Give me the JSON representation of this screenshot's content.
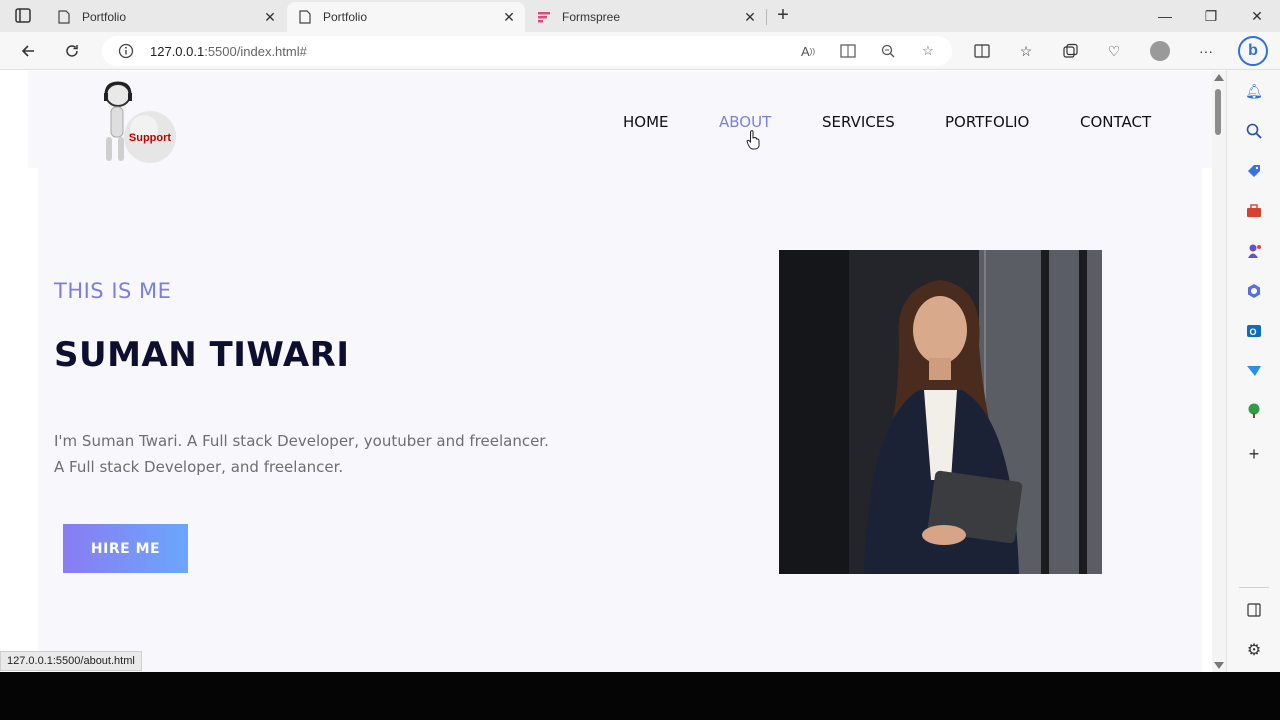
{
  "browser": {
    "tabs": [
      {
        "title": "Portfolio",
        "active": false
      },
      {
        "title": "Portfolio",
        "active": true
      },
      {
        "title": "Formspree",
        "active": false
      }
    ],
    "url_host": "127.0.0.1",
    "url_rest": ":5500/index.html#",
    "status_url": "127.0.0.1:5500/about.html"
  },
  "site": {
    "logo_text": "Support",
    "nav": [
      "HOME",
      "ABOUT",
      "SERVICES",
      "PORTFOLIO",
      "CONTACT"
    ],
    "active_nav": "ABOUT",
    "hero": {
      "eyebrow": "THIS IS ME",
      "name": "SUMAN TIWARI",
      "bio_line1": "I'm Suman Twari. A Full stack Developer, youtuber and freelancer.",
      "bio_line2": "A Full stack Developer, and freelancer.",
      "cta": "HIRE ME"
    }
  },
  "colors": {
    "accent": "#7b7fe0",
    "heading": "#0e0f2e",
    "cta_gradient_start": "#8a7cf2",
    "cta_gradient_end": "#6aa7fb"
  }
}
